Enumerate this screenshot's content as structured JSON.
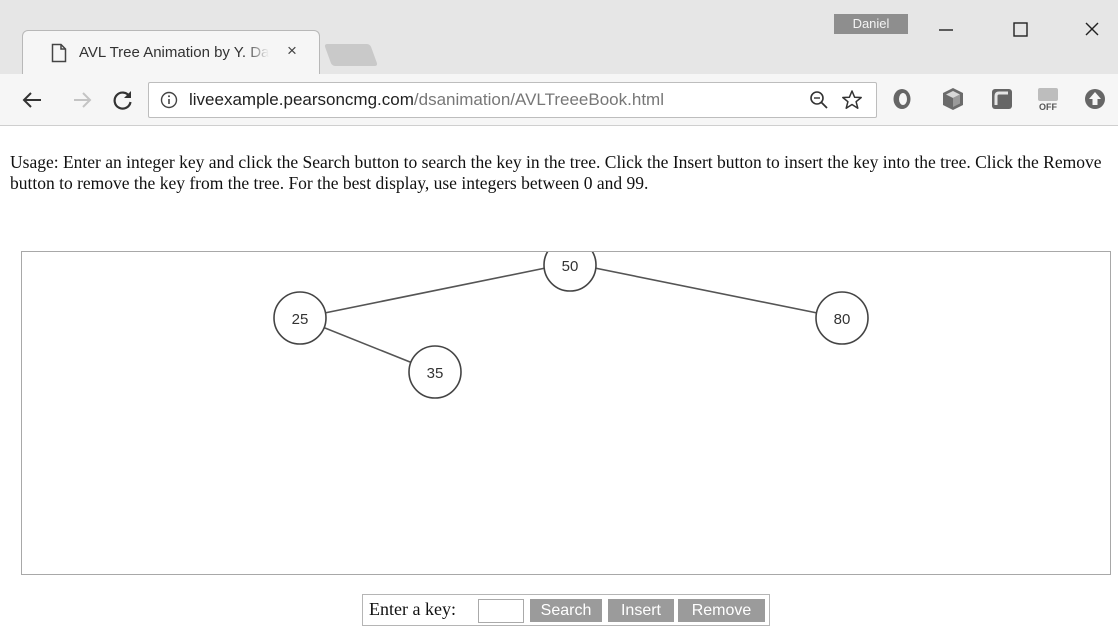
{
  "browser": {
    "tab_title": "AVL Tree Animation by Y. Daniel Liang",
    "close_tab_glyph": "×",
    "user_name": "Daniel",
    "url_host": "liveexample.pearsoncmg.com",
    "url_path": "/dsanimation/AVLTreeeBook.html",
    "extension_icons": [
      "circle-extension-icon",
      "cube-extension-icon",
      "square-extension-icon",
      "off-extension-icon",
      "upload-extension-icon"
    ],
    "off_badge": "OFF"
  },
  "page": {
    "usage": "Usage: Enter an integer key and click the Search button to search the key in the tree. Click the Insert button to insert the key into the tree. Click the Remove button to remove the key from the tree. For the best display, use integers between 0 and 99.",
    "tree": {
      "nodes": [
        {
          "key": "50",
          "role": "root"
        },
        {
          "key": "25",
          "role": "left child of 50"
        },
        {
          "key": "80",
          "role": "right child of 50"
        },
        {
          "key": "35",
          "role": "right child of 25"
        }
      ],
      "edges": [
        [
          "50",
          "25"
        ],
        [
          "50",
          "80"
        ],
        [
          "25",
          "35"
        ]
      ]
    },
    "controls": {
      "label": "Enter a key:",
      "input_value": "",
      "search_label": "Search",
      "insert_label": "Insert",
      "remove_label": "Remove"
    }
  },
  "colors": {
    "button_bg": "#9b9b9b",
    "node_stroke": "#444444",
    "chrome_bg": "#e6e6e6"
  }
}
